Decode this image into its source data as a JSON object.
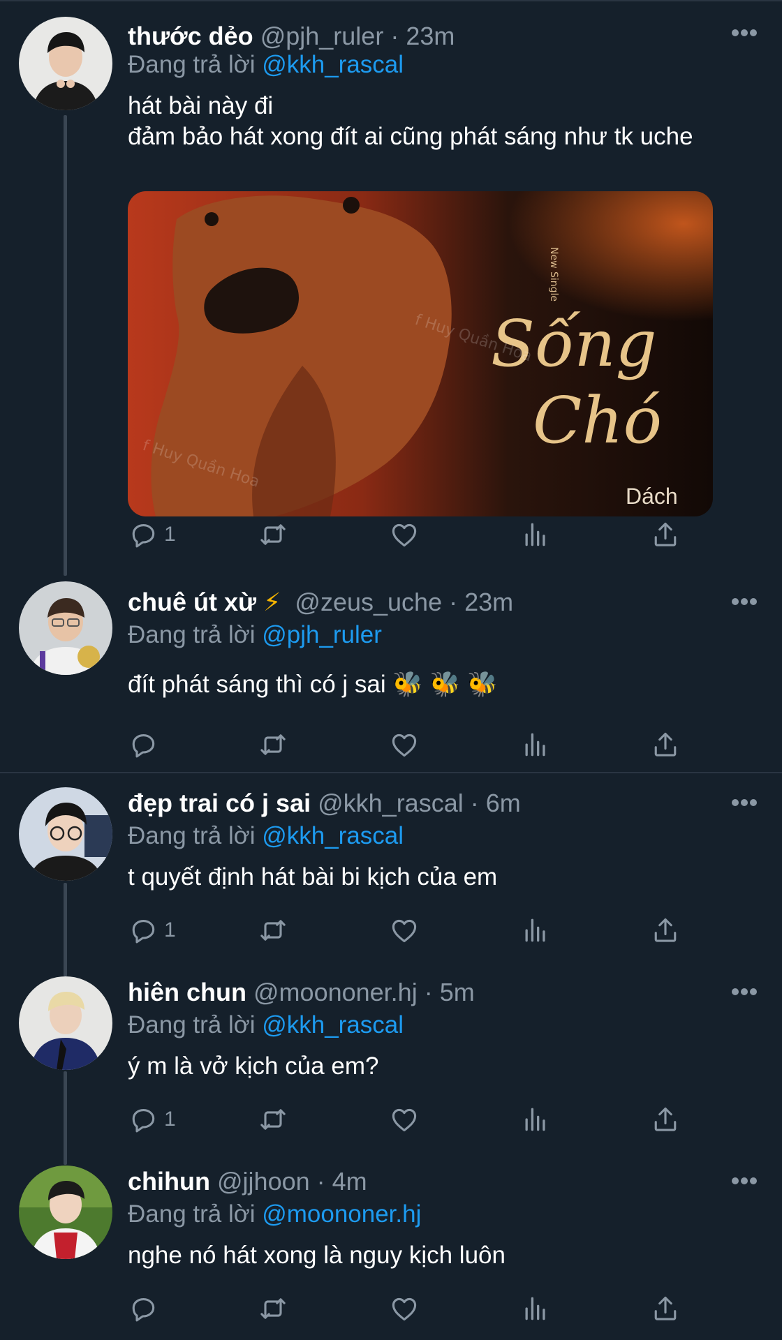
{
  "tweets": [
    {
      "name": "thước dẻo",
      "handle": "@pjh_ruler",
      "time": "· 23m",
      "reply_prefix": "Đang trả lời",
      "reply_to": "@kkh_rascal",
      "lines": [
        "hát bài này đi",
        "đảm bảo hát xong đít ai cũng phát sáng như tk uche"
      ],
      "replies_count": "1",
      "media": {
        "vertical_text": "New Single",
        "title_line1": "Sống",
        "title_line2": "Chó",
        "artist": "Dách",
        "watermark": "f Huy Quần Hoa"
      }
    },
    {
      "name": "chuê út xừ",
      "name_emoji": "⚡",
      "handle": "@zeus_uche",
      "time": "· 23m",
      "reply_prefix": "Đang trả lời",
      "reply_to": "@pjh_ruler",
      "lines": [
        "đít phát sáng thì có j sai 🐝 🐝 🐝"
      ],
      "replies_count": ""
    },
    {
      "name": "đẹp trai có j sai",
      "handle": "@kkh_rascal",
      "time": "· 6m",
      "reply_prefix": "Đang trả lời",
      "reply_to": "@kkh_rascal",
      "lines": [
        "t quyết định hát bài bi kịch của em"
      ],
      "replies_count": "1"
    },
    {
      "name": "hiên chun",
      "handle": "@moononer.hj",
      "time": "· 5m",
      "reply_prefix": "Đang trả lời",
      "reply_to": "@kkh_rascal",
      "lines": [
        "ý m là vở kịch của em?"
      ],
      "replies_count": "1"
    },
    {
      "name": "chihun",
      "handle": "@jjhoon",
      "time": "· 4m",
      "reply_prefix": "Đang trả lời",
      "reply_to": "@moononer.hj",
      "lines": [
        "nghe nó hát xong là nguy kịch luôn"
      ],
      "replies_count": ""
    }
  ],
  "icons": {
    "reply": "reply-icon",
    "retweet": "retweet-icon",
    "like": "heart-icon",
    "views": "views-icon",
    "share": "share-icon",
    "more": "more-icon"
  },
  "colors": {
    "background": "#15202b",
    "mention": "#1d9bf0",
    "muted": "#8b98a5"
  }
}
